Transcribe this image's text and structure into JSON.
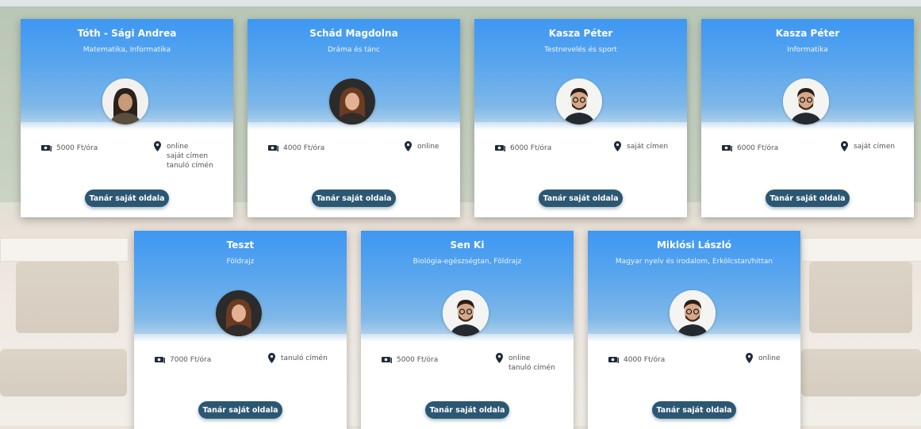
{
  "colors": {
    "header_gradient_top": "#3d97f2",
    "button_bg": "#2c5773",
    "text_muted": "#555555"
  },
  "icons": {
    "price": "money-bill-icon",
    "location": "map-marker-icon",
    "avatar": "teacher-photo"
  },
  "teachers": [
    {
      "name": "Tóth - Sági Andrea",
      "subjects": "Matematika, Informatika",
      "price": "5000 Ft/óra",
      "locations": [
        "online",
        "saját címen",
        "tanuló címén"
      ],
      "button": "Tanár saját oldala"
    },
    {
      "name": "Schád Magdolna",
      "subjects": "Dráma és tánc",
      "price": "4000 Ft/óra",
      "locations": [
        "online"
      ],
      "button": "Tanár saját oldala"
    },
    {
      "name": "Kasza Péter",
      "subjects": "Testnevelés és sport",
      "price": "6000 Ft/óra",
      "locations": [
        "saját címen"
      ],
      "button": "Tanár saját oldala"
    },
    {
      "name": "Kasza Péter",
      "subjects": "Informatika",
      "price": "6000 Ft/óra",
      "locations": [
        "saját címen"
      ],
      "button": "Tanár saját oldala"
    },
    {
      "name": "Teszt",
      "subjects": "Földrajz",
      "price": "7000 Ft/óra",
      "locations": [
        "tanuló címén"
      ],
      "button": "Tanár saját oldala"
    },
    {
      "name": "Sen Ki",
      "subjects": "Biológia-egészségtan, Földrajz",
      "price": "5000 Ft/óra",
      "locations": [
        "online",
        "tanuló címén"
      ],
      "button": "Tanár saját oldala"
    },
    {
      "name": "Miklósi László",
      "subjects": "Magyar nyelv és irodalom, Erkölcstan/hittan",
      "price": "4000 Ft/óra",
      "locations": [
        "online"
      ],
      "button": "Tanár saját oldala"
    }
  ]
}
